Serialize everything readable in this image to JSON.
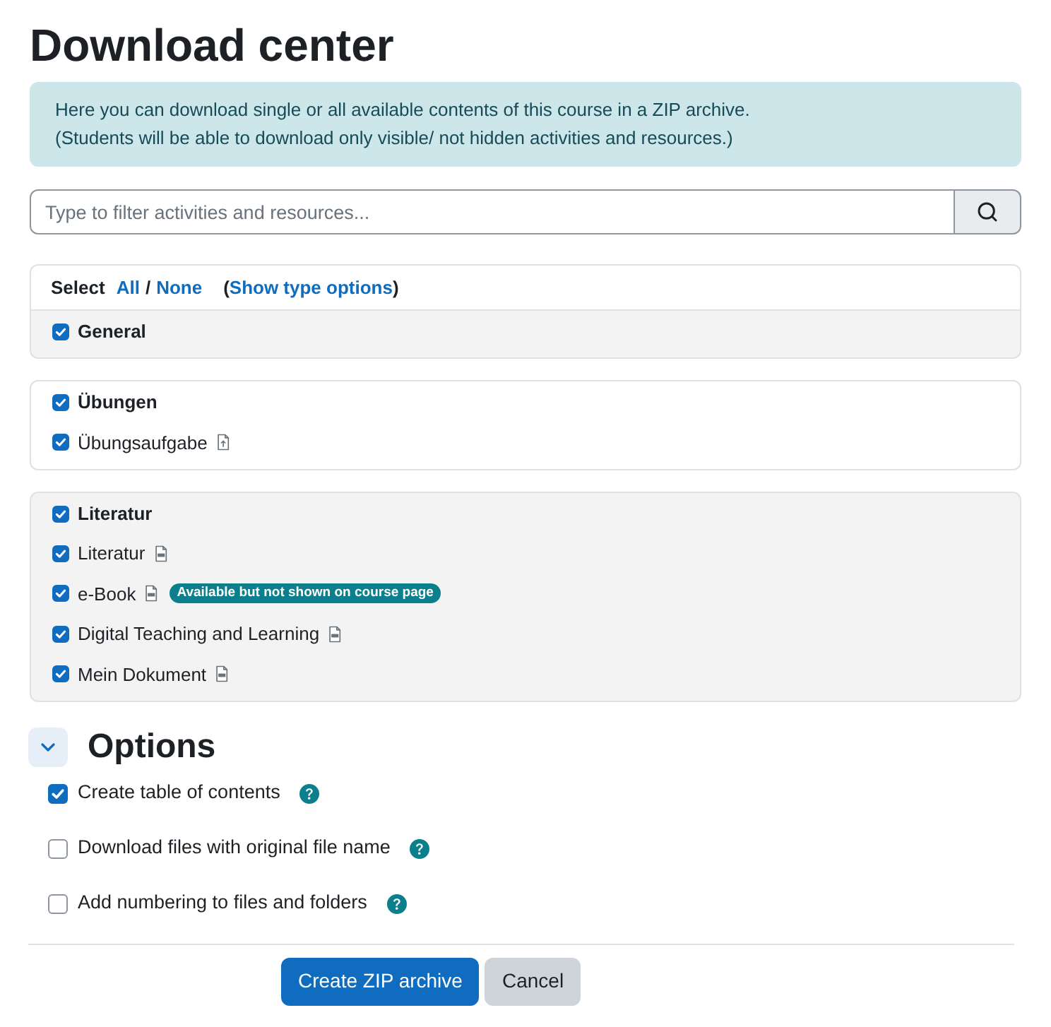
{
  "title": "Download center",
  "alert": {
    "lines": [
      "Here you can download single or all available contents of this course in a ZIP archive.",
      "(Students will be able to download only visible/ not hidden activities and resources.)"
    ]
  },
  "filter": {
    "placeholder": "Type to filter activities and resources..."
  },
  "select_bar": {
    "label": "Select",
    "all": "All",
    "separator": "/",
    "none": "None",
    "type_options": {
      "open": "(",
      "link": "Show type options",
      "close": ")"
    }
  },
  "sections": [
    {
      "title": "General",
      "checked": true,
      "highlighted": true
    },
    {
      "title": "Übungen",
      "checked": true,
      "highlighted": false,
      "items": [
        {
          "label": "Übungsaufgabe",
          "checked": true,
          "kind": "assignment"
        }
      ]
    },
    {
      "title": "Literatur",
      "checked": true,
      "highlighted": true,
      "items": [
        {
          "label": "Literatur",
          "checked": true,
          "kind": "file"
        },
        {
          "label": "e-Book",
          "checked": true,
          "kind": "file",
          "badge": "Available but not shown on course page"
        },
        {
          "label": "Digital Teaching and Learning",
          "checked": true,
          "kind": "file"
        },
        {
          "label": "Mein Dokument",
          "checked": true,
          "kind": "file"
        }
      ]
    }
  ],
  "options": {
    "title": "Options",
    "expanded": true,
    "fields": [
      {
        "label": "Create table of contents",
        "checked": true
      },
      {
        "label": "Download files with original file name",
        "checked": false
      },
      {
        "label": "Add numbering to files and folders",
        "checked": false
      }
    ]
  },
  "buttons": [
    {
      "label": "Create ZIP archive",
      "kind": "primary"
    },
    {
      "label": "Cancel",
      "kind": "secondary"
    }
  ]
}
